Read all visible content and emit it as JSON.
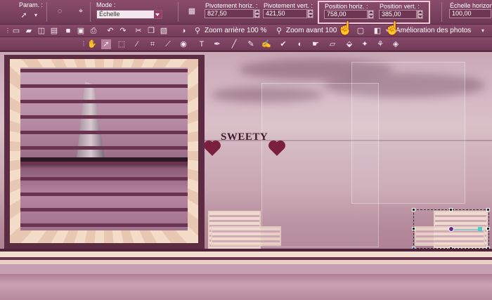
{
  "toolbar1": {
    "params_label": "Param. :",
    "mode_label": "Mode :",
    "mode_value": "Échelle",
    "pivot_h_label": "Pivotement horiz. :",
    "pivot_h_value": "827,50",
    "pivot_v_label": "Pivotement vert. :",
    "pivot_v_value": "421,50",
    "pos_h_label": "Position horiz. :",
    "pos_h_value": "758,00",
    "pos_v_label": "Position vert. :",
    "pos_v_value": "385,00",
    "scale_h_label": "Échelle horizont",
    "scale_h_value": "100,00"
  },
  "toolbar2": {
    "zoom_out_label": "Zoom arrière 100 %",
    "zoom_in_label": "Zoom avant 100",
    "enhance_label": "Amélioration des photos"
  },
  "canvas": {
    "watermark_text": "SWEETY"
  },
  "icons": [
    "pointer-icon",
    "pick-tool-icon",
    "new-file-icon",
    "open-icon",
    "save-icon",
    "undo-icon",
    "redo-icon",
    "zoom-icon",
    "hand-icon",
    "selection-icon",
    "brush-icon",
    "eraser-icon",
    "dropper-icon"
  ],
  "colors": {
    "accent": "#f4c9dc",
    "toolbar": "#7a4361",
    "frame": "#5c2c43"
  }
}
